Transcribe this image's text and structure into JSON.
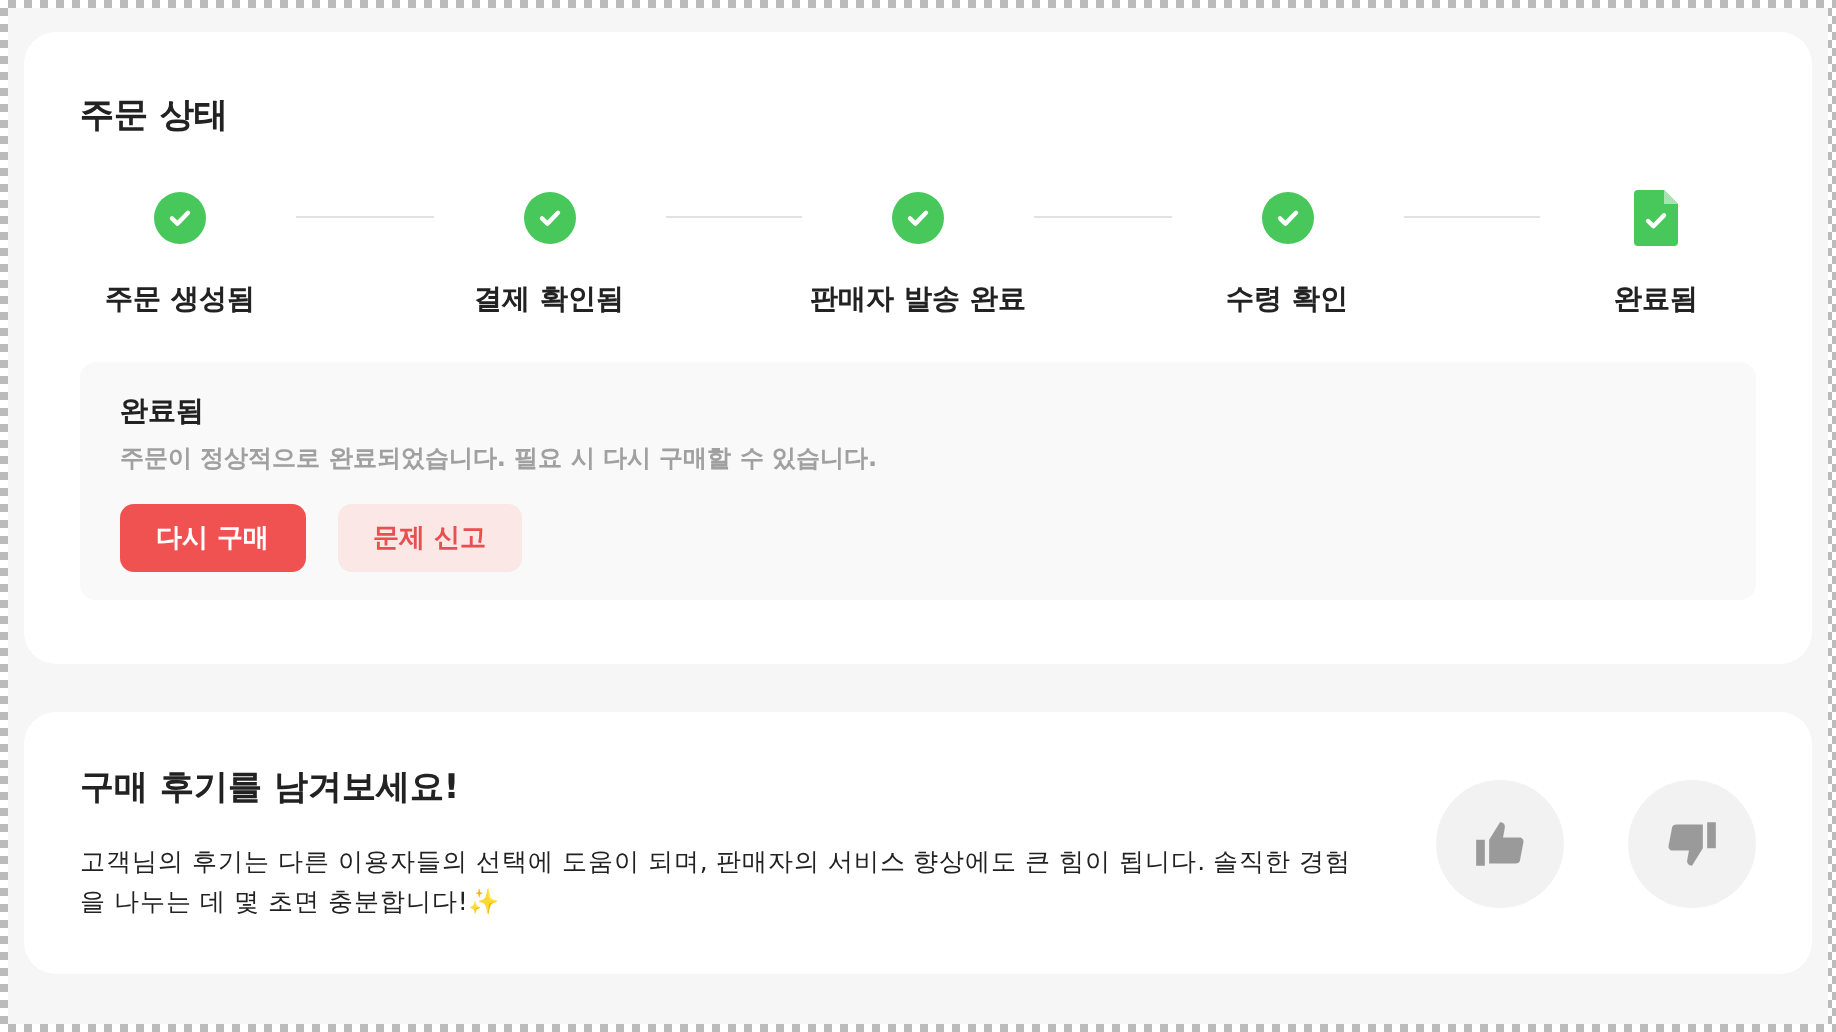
{
  "order_status": {
    "title": "주문 상태",
    "steps": [
      {
        "label": "주문 생성됨",
        "kind": "check",
        "completed": true
      },
      {
        "label": "결제 확인됨",
        "kind": "check",
        "completed": true
      },
      {
        "label": "판매자 발송 완료",
        "kind": "check",
        "completed": true
      },
      {
        "label": "수령 확인",
        "kind": "check",
        "completed": true
      },
      {
        "label": "완료됨",
        "kind": "document",
        "completed": true
      }
    ],
    "notice": {
      "title": "완료됨",
      "message": "주문이 정상적으로 완료되었습니다. 필요 시 다시 구매할 수 있습니다.",
      "buttons": [
        {
          "label": "다시 구매",
          "kind": "primary"
        },
        {
          "label": "문제 신고",
          "kind": "secondary"
        }
      ]
    }
  },
  "review": {
    "title": "구매 후기를 남겨보세요!",
    "text": "고객님의 후기는 다른 이용자들의 선택에 도움이 되며, 판매자의 서비스 향상에도 큰 힘이 됩니다. 솔직한 경험을 나누는 데 몇 초면 충분합니다!✨",
    "reactions": [
      {
        "kind": "like"
      },
      {
        "kind": "dislike"
      }
    ]
  }
}
